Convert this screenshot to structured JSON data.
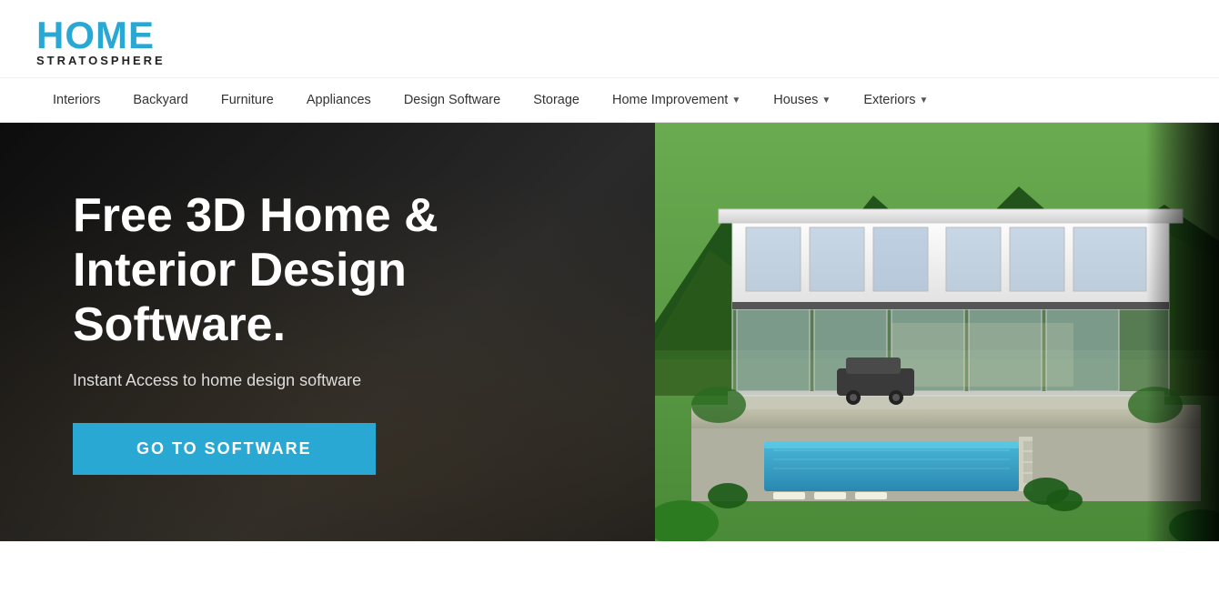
{
  "logo": {
    "home": "HOME",
    "stratosphere": "STRATOSPHERE"
  },
  "nav": {
    "items": [
      {
        "label": "Interiors",
        "hasDropdown": false
      },
      {
        "label": "Backyard",
        "hasDropdown": false
      },
      {
        "label": "Furniture",
        "hasDropdown": false
      },
      {
        "label": "Appliances",
        "hasDropdown": false
      },
      {
        "label": "Design Software",
        "hasDropdown": false
      },
      {
        "label": "Storage",
        "hasDropdown": false
      },
      {
        "label": "Home Improvement",
        "hasDropdown": true
      },
      {
        "label": "Houses",
        "hasDropdown": true
      },
      {
        "label": "Exteriors",
        "hasDropdown": true
      }
    ]
  },
  "hero": {
    "title": "Free 3D Home & Interior Design Software.",
    "subtitle": "Instant Access to home design software",
    "button_label": "GO TO SOFTWARE",
    "colors": {
      "button_bg": "#2aa8d4"
    }
  }
}
